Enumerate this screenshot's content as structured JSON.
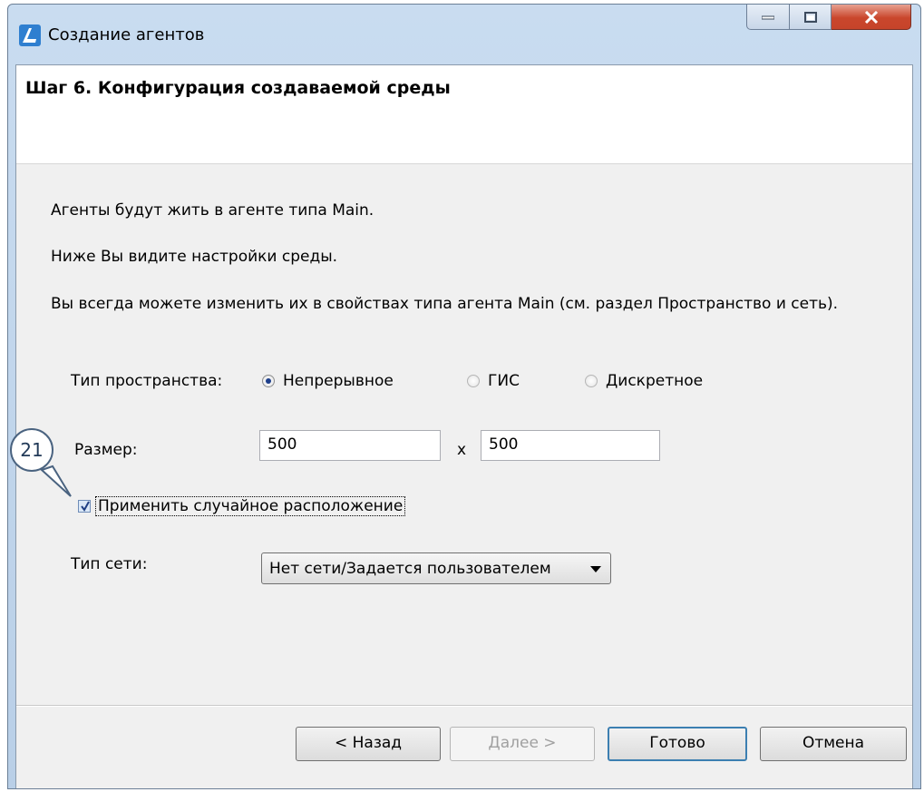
{
  "window": {
    "title": "Создание агентов",
    "close_label": "x"
  },
  "header": {
    "step_title": "Шаг 6. Конфигурация создаваемой среды"
  },
  "body": {
    "line1": "Агенты будут жить в агенте типа Main.",
    "line2": "Ниже Вы видите настройки среды.",
    "line3": "Вы всегда можете изменить их в свойствах типа агента Main (см. раздел Пространство и сеть)."
  },
  "space": {
    "label": "Тип пространства:",
    "options": [
      "Непрерывное",
      "ГИС",
      "Дискретное"
    ],
    "selected": "Непрерывное"
  },
  "size": {
    "label": "Размер:",
    "width": "500",
    "separator": "x",
    "height": "500"
  },
  "random_layout": {
    "label": "Применить случайное расположение",
    "checked": true
  },
  "network": {
    "label": "Тип сети:",
    "selected": "Нет сети/Задается пользователем"
  },
  "buttons": {
    "back": "< Назад",
    "next": "Далее >",
    "finish": "Готово",
    "cancel": "Отмена"
  },
  "callout": {
    "number": "21"
  }
}
